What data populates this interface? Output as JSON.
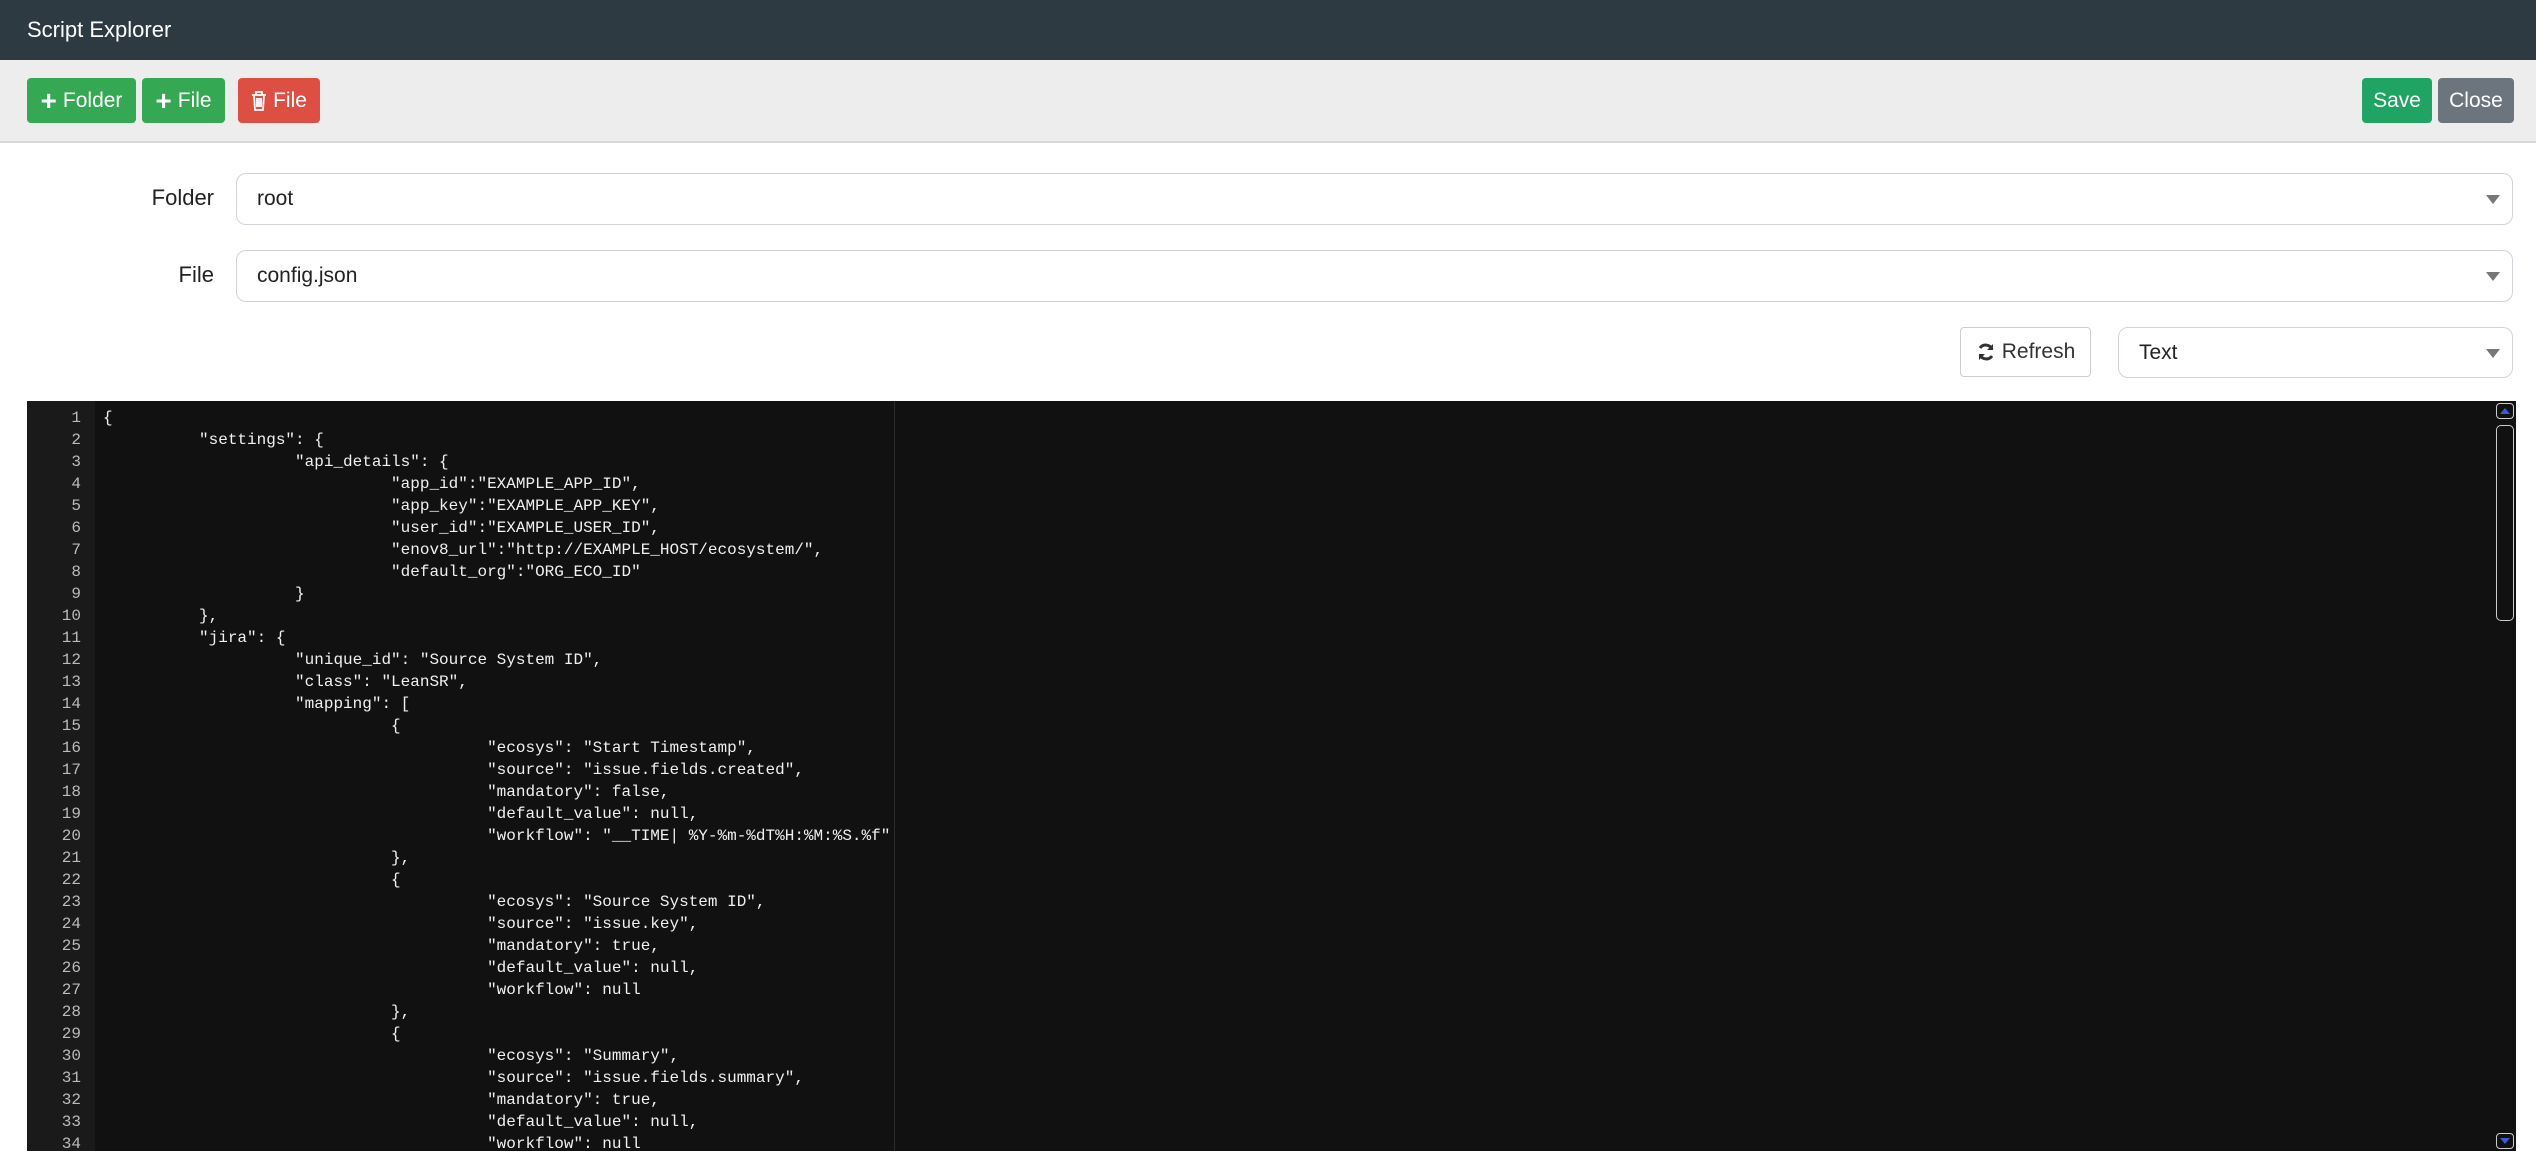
{
  "header": {
    "title": "Script Explorer"
  },
  "toolbar": {
    "add_folder_label": "Folder",
    "add_file_label": "File",
    "delete_file_label": "File",
    "save_label": "Save",
    "close_label": "Close",
    "icons": {
      "add": "plus-icon",
      "delete": "trash-icon",
      "refresh": "refresh-icon"
    }
  },
  "form": {
    "folder_label": "Folder",
    "folder_value": "root",
    "file_label": "File",
    "file_value": "config.json",
    "refresh_label": "Refresh",
    "mode_value": "Text"
  },
  "colors": {
    "green": "#34a853",
    "red": "#dd4f43",
    "save": "#1fa463",
    "gray": "#6c757d",
    "header": "#2e3a41"
  },
  "editor": {
    "lines": [
      "{",
      "\t\"settings\": {",
      "\t\t\"api_details\": {",
      "\t\t\t\"app_id\":\"EXAMPLE_APP_ID\",",
      "\t\t\t\"app_key\":\"EXAMPLE_APP_KEY\",",
      "\t\t\t\"user_id\":\"EXAMPLE_USER_ID\",",
      "\t\t\t\"enov8_url\":\"http://EXAMPLE_HOST/ecosystem/\",",
      "\t\t\t\"default_org\":\"ORG_ECO_ID\"",
      "\t\t}",
      "\t},",
      "\t\"jira\": {",
      "\t\t\"unique_id\": \"Source System ID\",",
      "\t\t\"class\": \"LeanSR\",",
      "\t\t\"mapping\": [",
      "\t\t\t{",
      "\t\t\t\t\"ecosys\": \"Start Timestamp\",",
      "\t\t\t\t\"source\": \"issue.fields.created\",",
      "\t\t\t\t\"mandatory\": false,",
      "\t\t\t\t\"default_value\": null,",
      "\t\t\t\t\"workflow\": \"__TIME| %Y-%m-%dT%H:%M:%S.%f\"",
      "\t\t\t},",
      "\t\t\t{",
      "\t\t\t\t\"ecosys\": \"Source System ID\",",
      "\t\t\t\t\"source\": \"issue.key\",",
      "\t\t\t\t\"mandatory\": true,",
      "\t\t\t\t\"default_value\": null,",
      "\t\t\t\t\"workflow\": null",
      "\t\t\t},",
      "\t\t\t{",
      "\t\t\t\t\"ecosys\": \"Summary\",",
      "\t\t\t\t\"source\": \"issue.fields.summary\",",
      "\t\t\t\t\"mandatory\": true,",
      "\t\t\t\t\"default_value\": null,",
      "\t\t\t\t\"workflow\": null"
    ]
  }
}
